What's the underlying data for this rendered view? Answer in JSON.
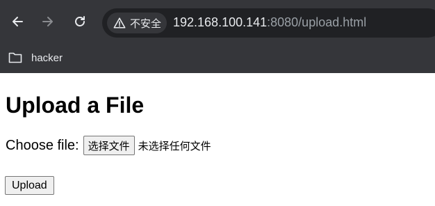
{
  "browser": {
    "security_label": "不安全",
    "url_host": "192.168.100.141",
    "url_rest": ":8080/upload.html",
    "bookmarks": [
      {
        "label": "hacker",
        "icon": "folder-icon"
      }
    ]
  },
  "page": {
    "heading": "Upload a File",
    "file_label": "Choose file:",
    "file_button": "选择文件",
    "file_status": "未选择任何文件",
    "upload_button": "Upload"
  }
}
